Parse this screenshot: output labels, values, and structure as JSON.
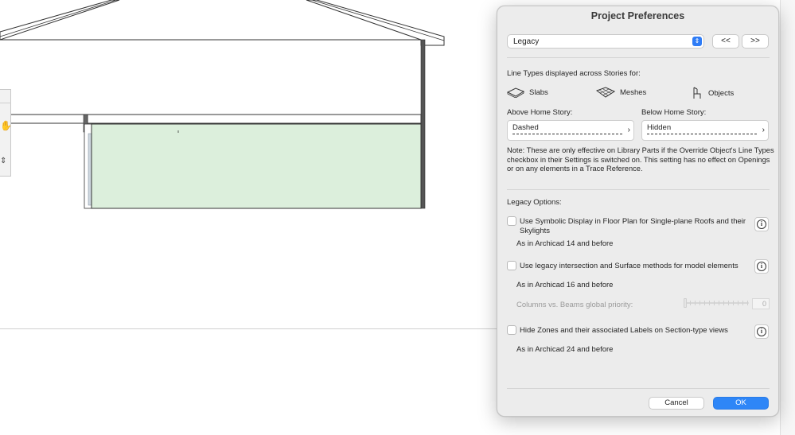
{
  "dialog": {
    "title": "Project Preferences",
    "panel_selector": {
      "value": "Legacy"
    },
    "prev_label": "<<",
    "next_label": ">>",
    "line_types_heading": "Line Types displayed across Stories for:",
    "types": {
      "slabs": "Slabs",
      "meshes": "Meshes",
      "objects": "Objects"
    },
    "above_label": "Above Home Story:",
    "below_label": "Below Home Story:",
    "above_value": "Dashed",
    "below_value": "Hidden",
    "note": "Note: These are only effective on Library Parts if the Override Object's Line Types checkbox in their Settings is switched on. This setting has no effect on Openings or on any elements in a Trace Reference.",
    "legacy_heading": "Legacy Options:",
    "options": [
      {
        "label": "Use Symbolic Display in Floor Plan for Single-plane Roofs and their Skylights",
        "hint": "As in Archicad 14 and before",
        "checked": false
      },
      {
        "label": "Use legacy intersection and Surface methods for model elements",
        "hint": "As in Archicad 16 and before",
        "checked": false
      },
      {
        "label": "Hide Zones and their associated Labels on Section-type views",
        "hint": "As in Archicad 24 and before",
        "checked": false
      }
    ],
    "priority_label": "Columns vs. Beams global priority:",
    "priority_value": "0",
    "cancel_label": "Cancel",
    "ok_label": "OK"
  },
  "colors": {
    "accent": "#2e86f7",
    "zone_fill": "#dcefdc",
    "dialog_bg": "#ececec"
  }
}
